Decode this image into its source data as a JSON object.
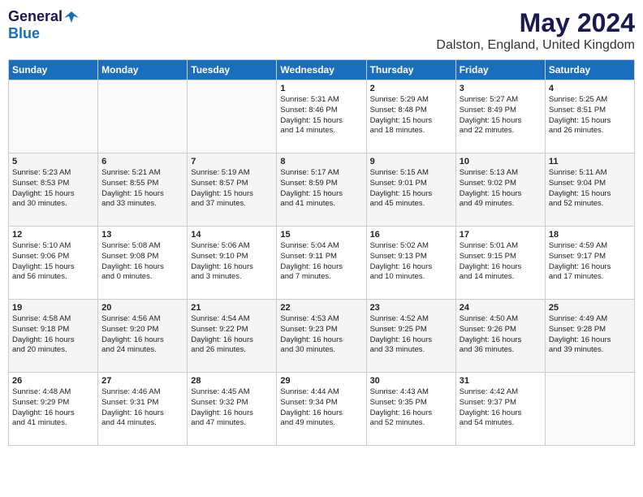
{
  "logo": {
    "general": "General",
    "blue": "Blue"
  },
  "title": "May 2024",
  "location": "Dalston, England, United Kingdom",
  "days_of_week": [
    "Sunday",
    "Monday",
    "Tuesday",
    "Wednesday",
    "Thursday",
    "Friday",
    "Saturday"
  ],
  "weeks": [
    [
      {
        "day": "",
        "content": ""
      },
      {
        "day": "",
        "content": ""
      },
      {
        "day": "",
        "content": ""
      },
      {
        "day": "1",
        "content": "Sunrise: 5:31 AM\nSunset: 8:46 PM\nDaylight: 15 hours\nand 14 minutes."
      },
      {
        "day": "2",
        "content": "Sunrise: 5:29 AM\nSunset: 8:48 PM\nDaylight: 15 hours\nand 18 minutes."
      },
      {
        "day": "3",
        "content": "Sunrise: 5:27 AM\nSunset: 8:49 PM\nDaylight: 15 hours\nand 22 minutes."
      },
      {
        "day": "4",
        "content": "Sunrise: 5:25 AM\nSunset: 8:51 PM\nDaylight: 15 hours\nand 26 minutes."
      }
    ],
    [
      {
        "day": "5",
        "content": "Sunrise: 5:23 AM\nSunset: 8:53 PM\nDaylight: 15 hours\nand 30 minutes."
      },
      {
        "day": "6",
        "content": "Sunrise: 5:21 AM\nSunset: 8:55 PM\nDaylight: 15 hours\nand 33 minutes."
      },
      {
        "day": "7",
        "content": "Sunrise: 5:19 AM\nSunset: 8:57 PM\nDaylight: 15 hours\nand 37 minutes."
      },
      {
        "day": "8",
        "content": "Sunrise: 5:17 AM\nSunset: 8:59 PM\nDaylight: 15 hours\nand 41 minutes."
      },
      {
        "day": "9",
        "content": "Sunrise: 5:15 AM\nSunset: 9:01 PM\nDaylight: 15 hours\nand 45 minutes."
      },
      {
        "day": "10",
        "content": "Sunrise: 5:13 AM\nSunset: 9:02 PM\nDaylight: 15 hours\nand 49 minutes."
      },
      {
        "day": "11",
        "content": "Sunrise: 5:11 AM\nSunset: 9:04 PM\nDaylight: 15 hours\nand 52 minutes."
      }
    ],
    [
      {
        "day": "12",
        "content": "Sunrise: 5:10 AM\nSunset: 9:06 PM\nDaylight: 15 hours\nand 56 minutes."
      },
      {
        "day": "13",
        "content": "Sunrise: 5:08 AM\nSunset: 9:08 PM\nDaylight: 16 hours\nand 0 minutes."
      },
      {
        "day": "14",
        "content": "Sunrise: 5:06 AM\nSunset: 9:10 PM\nDaylight: 16 hours\nand 3 minutes."
      },
      {
        "day": "15",
        "content": "Sunrise: 5:04 AM\nSunset: 9:11 PM\nDaylight: 16 hours\nand 7 minutes."
      },
      {
        "day": "16",
        "content": "Sunrise: 5:02 AM\nSunset: 9:13 PM\nDaylight: 16 hours\nand 10 minutes."
      },
      {
        "day": "17",
        "content": "Sunrise: 5:01 AM\nSunset: 9:15 PM\nDaylight: 16 hours\nand 14 minutes."
      },
      {
        "day": "18",
        "content": "Sunrise: 4:59 AM\nSunset: 9:17 PM\nDaylight: 16 hours\nand 17 minutes."
      }
    ],
    [
      {
        "day": "19",
        "content": "Sunrise: 4:58 AM\nSunset: 9:18 PM\nDaylight: 16 hours\nand 20 minutes."
      },
      {
        "day": "20",
        "content": "Sunrise: 4:56 AM\nSunset: 9:20 PM\nDaylight: 16 hours\nand 24 minutes."
      },
      {
        "day": "21",
        "content": "Sunrise: 4:54 AM\nSunset: 9:22 PM\nDaylight: 16 hours\nand 26 minutes."
      },
      {
        "day": "22",
        "content": "Sunrise: 4:53 AM\nSunset: 9:23 PM\nDaylight: 16 hours\nand 30 minutes."
      },
      {
        "day": "23",
        "content": "Sunrise: 4:52 AM\nSunset: 9:25 PM\nDaylight: 16 hours\nand 33 minutes."
      },
      {
        "day": "24",
        "content": "Sunrise: 4:50 AM\nSunset: 9:26 PM\nDaylight: 16 hours\nand 36 minutes."
      },
      {
        "day": "25",
        "content": "Sunrise: 4:49 AM\nSunset: 9:28 PM\nDaylight: 16 hours\nand 39 minutes."
      }
    ],
    [
      {
        "day": "26",
        "content": "Sunrise: 4:48 AM\nSunset: 9:29 PM\nDaylight: 16 hours\nand 41 minutes."
      },
      {
        "day": "27",
        "content": "Sunrise: 4:46 AM\nSunset: 9:31 PM\nDaylight: 16 hours\nand 44 minutes."
      },
      {
        "day": "28",
        "content": "Sunrise: 4:45 AM\nSunset: 9:32 PM\nDaylight: 16 hours\nand 47 minutes."
      },
      {
        "day": "29",
        "content": "Sunrise: 4:44 AM\nSunset: 9:34 PM\nDaylight: 16 hours\nand 49 minutes."
      },
      {
        "day": "30",
        "content": "Sunrise: 4:43 AM\nSunset: 9:35 PM\nDaylight: 16 hours\nand 52 minutes."
      },
      {
        "day": "31",
        "content": "Sunrise: 4:42 AM\nSunset: 9:37 PM\nDaylight: 16 hours\nand 54 minutes."
      },
      {
        "day": "",
        "content": ""
      }
    ]
  ]
}
